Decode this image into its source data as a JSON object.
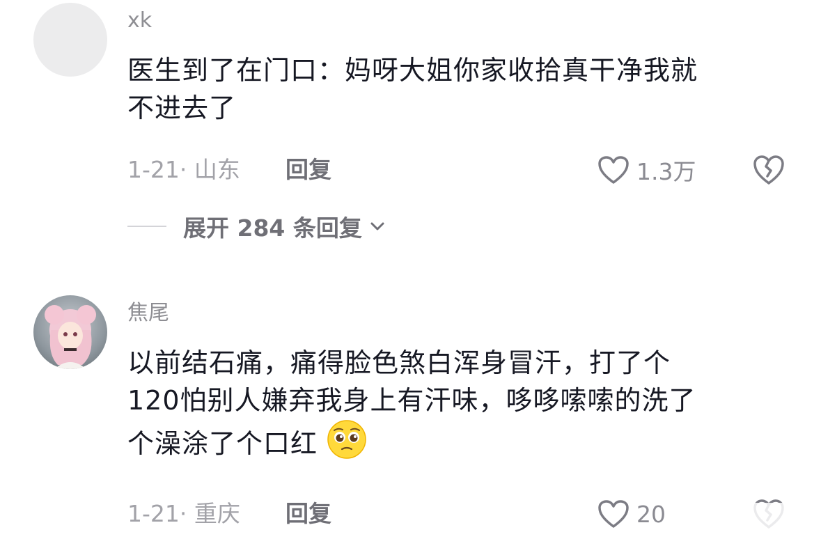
{
  "comments": [
    {
      "username": "xk",
      "text_line1": "医生到了在门口：妈呀大姐你家收拾真干净我就",
      "text_line2": "不进去了",
      "date_location": "1-21· 山东",
      "reply_label": "回复",
      "like_count": "1.3万"
    },
    {
      "username": "焦尾",
      "text_line1": "以前结石痛，痛得脸色煞白浑身冒汗，打了个",
      "text_line2": "120怕别人嫌弃我身上有汗味，哆哆嗦嗦的洗了",
      "text_line3": "个澡涂了个口红",
      "date_location": "1-21· 重庆",
      "reply_label": "回复",
      "like_count": "20"
    }
  ],
  "expand_replies": {
    "label": "展开 284 条回复"
  },
  "icons": {
    "like": "heart-outline-icon",
    "dislike": "broken-heart-icon",
    "expand": "chevron-down-icon",
    "emoji": "pleading-face-emoji"
  },
  "colors": {
    "primary_text": "#161823",
    "secondary_text": "#8e8e93",
    "accent": "#6f6f76"
  }
}
